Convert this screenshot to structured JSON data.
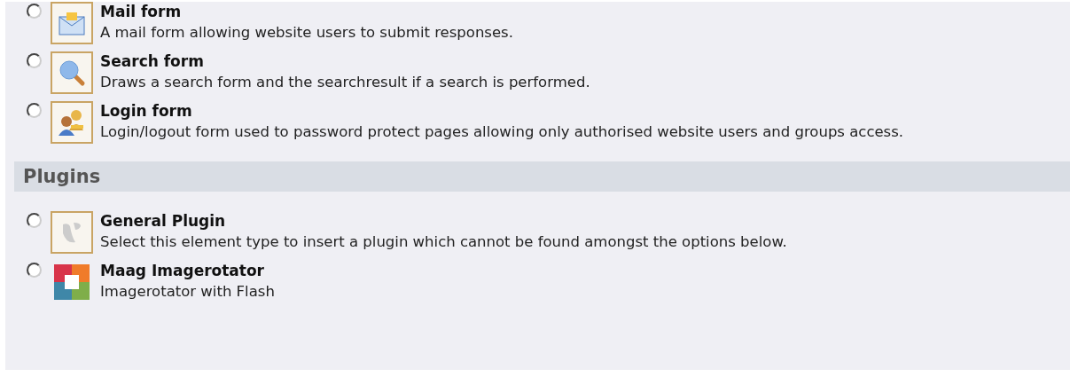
{
  "groups": [
    {
      "items": [
        {
          "kind": "mail",
          "title": "Mail form",
          "description": "A mail form allowing website users to submit responses.",
          "selected": false
        },
        {
          "kind": "search",
          "title": "Search form",
          "description": "Draws a search form and the searchresult if a search is performed.",
          "selected": false
        },
        {
          "kind": "login",
          "title": "Login form",
          "description": "Login/logout form used to password protect pages allowing only authorised website users and groups access.",
          "selected": false
        }
      ]
    },
    {
      "heading": "Plugins",
      "items": [
        {
          "kind": "plugin",
          "title": "General Plugin",
          "description": "Select this element type to insert a plugin which cannot be found amongst the options below.",
          "selected": false
        },
        {
          "kind": "rotator",
          "title": "Maag Imagerotator",
          "description": "Imagerotator with Flash",
          "selected": false
        }
      ]
    }
  ]
}
